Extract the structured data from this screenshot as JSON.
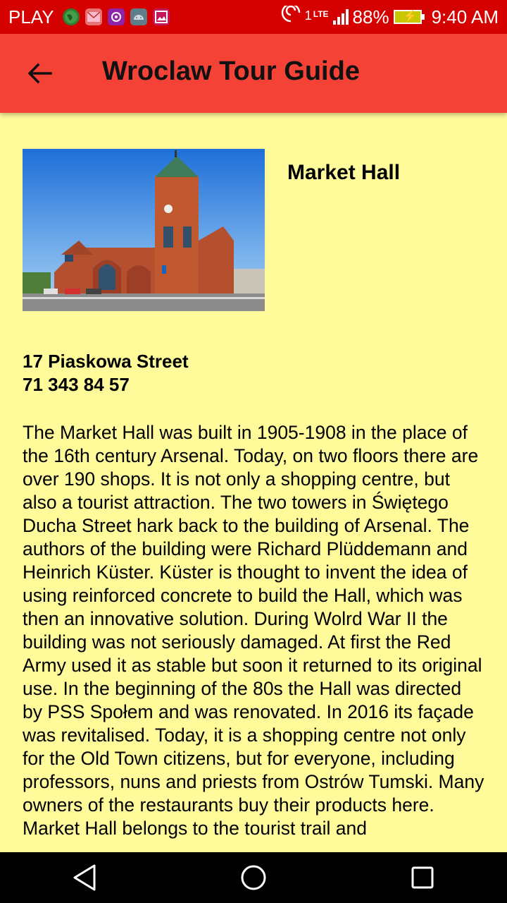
{
  "status_bar": {
    "carrier": "PLAY",
    "network": "1",
    "network_type": "LTE",
    "battery_percent": "88%",
    "time": "9:40 AM"
  },
  "app_bar": {
    "title": "Wroclaw Tour Guide"
  },
  "place": {
    "name": "Market Hall",
    "address": "17 Piaskowa Street",
    "phone": "71 343 84 57",
    "description": "The Market Hall was built in 1905-1908 in the place of the 16th century Arsenal. Today, on two floors there are over 190 shops. It is not only a shopping centre, but also a tourist attraction. The two towers in Świętego Ducha Street hark back to the building of Arsenal. The authors of the building were Richard Plüddemann and Heinrich Küster. Küster is thought to invent the idea of using reinforced concrete to build the Hall, which was then an innovative solution. During Wolrd War II the building was not seriously damaged. At first the Red Army used it as stable but soon it returned to its original use. In the beginning of the 80s the Hall was directed by PSS Społem and was renovated. In 2016 its façade was revitalised. Today, it is a shopping centre not only for the Old Town citizens, but for everyone, including professors, nuns and priests from Ostrów Tumski. Many owners of the restaurants buy their products here. Market Hall belongs to the tourist trail and"
  },
  "colors": {
    "status_bar": "#d50000",
    "app_bar": "#f44336",
    "background": "#fffb9a",
    "nav_bar": "#000000"
  },
  "icons": {
    "back": "arrow-left-icon",
    "nav_back": "triangle-back-icon",
    "nav_home": "circle-home-icon",
    "nav_recents": "square-recents-icon"
  }
}
